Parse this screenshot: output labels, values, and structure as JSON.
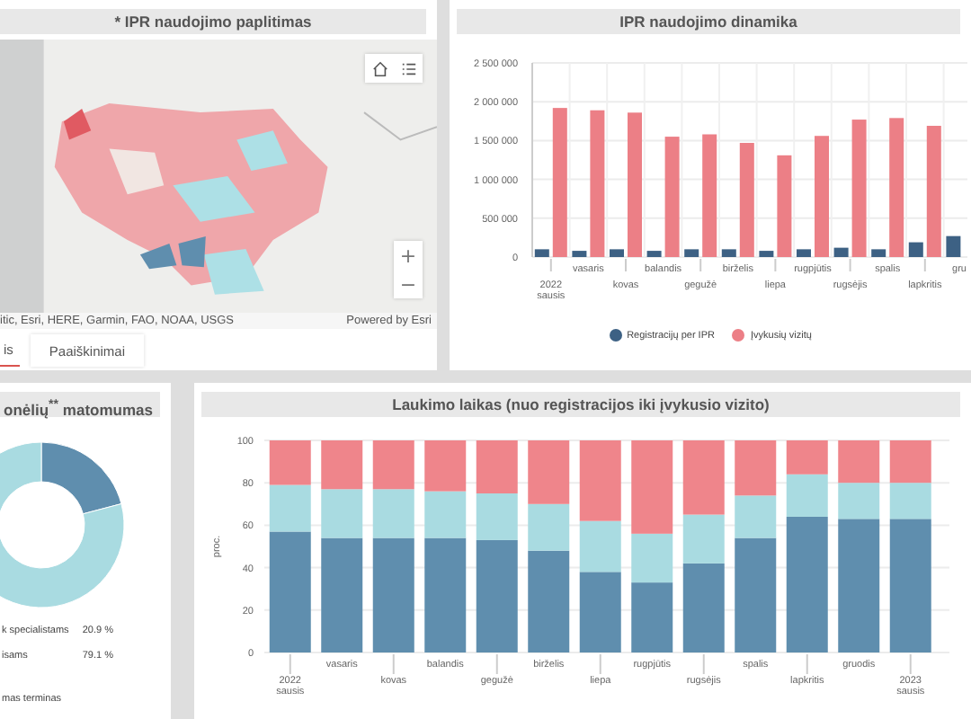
{
  "map_panel": {
    "title": "* IPR naudojimo paplitimas",
    "attribution": "itic, Esri, HERE, Garmin, FAO, NOAA, USGS",
    "powered_by": "Powered by Esri",
    "zoom_in": "+",
    "zoom_out": "−",
    "tabs": [
      {
        "label": "is",
        "selected": true
      },
      {
        "label": "Paaiškinimai",
        "selected": false
      }
    ]
  },
  "dynamics_panel": {
    "title": "IPR naudojimo dinamika",
    "chart_data": {
      "type": "bar",
      "grid": true,
      "categories": [
        "2022\nsausis",
        "vasaris",
        "kovas",
        "balandis",
        "gegužė",
        "birželis",
        "liepa",
        "rugpjūtis",
        "rugsėjis",
        "spalis",
        "lapkritis",
        "gru"
      ],
      "yticks": [
        {
          "value": 0,
          "label": "0"
        },
        {
          "value": 500000,
          "label": "500 000"
        },
        {
          "value": 1000000,
          "label": "1 000 000"
        },
        {
          "value": 1500000,
          "label": "1 500 000"
        },
        {
          "value": 2000000,
          "label": "2 000 000"
        },
        {
          "value": 2500000,
          "label": "2 500 000"
        }
      ],
      "ylim": [
        0,
        2500000
      ],
      "series": [
        {
          "name": "Registracijų per IPR",
          "color": "#3d6184",
          "values": [
            100000,
            80000,
            100000,
            80000,
            100000,
            100000,
            80000,
            100000,
            120000,
            100000,
            190000,
            270000
          ]
        },
        {
          "name": "Įvykusių vizitų",
          "color": "#ec7f86",
          "values": [
            1920000,
            1890000,
            1860000,
            1550000,
            1580000,
            1470000,
            1310000,
            1560000,
            1770000,
            1790000,
            1690000,
            null
          ]
        }
      ]
    }
  },
  "visibility_panel": {
    "title": "onėlių$^{**}$ matomumas",
    "legend": [
      {
        "label": "k specialistams",
        "value": "20.9 %",
        "color": "#5f8eae"
      },
      {
        "label": "isams",
        "value": "79.1 %",
        "color": "#a9dbe1"
      }
    ],
    "note": "mas terminas",
    "chart_data": {
      "type": "donut",
      "values": [
        20.9,
        79.1
      ]
    }
  },
  "waiting_panel": {
    "title": "Laukimo laikas (nuo registracijos iki įvykusio vizito)",
    "chart_data": {
      "type": "bar",
      "stacked": true,
      "grid": true,
      "ylabel": "proc.",
      "ylim": [
        0,
        100
      ],
      "yticks": [
        0,
        20,
        40,
        60,
        80,
        100
      ],
      "categories": [
        "2022\nsausis",
        "vasaris",
        "kovas",
        "balandis",
        "gegužė",
        "birželis",
        "liepa",
        "rugpjūtis",
        "rugsėjis",
        "spalis",
        "lapkritis",
        "gruodis",
        "2023\nsausis"
      ],
      "series": [
        {
          "color": "#5f8eae",
          "values": [
            57,
            54,
            54,
            54,
            53,
            48,
            38,
            33,
            42,
            54,
            64,
            63,
            63
          ]
        },
        {
          "color": "#a9dbe1",
          "values": [
            22,
            23,
            23,
            22,
            22,
            22,
            24,
            23,
            23,
            20,
            20,
            17,
            17
          ]
        },
        {
          "color": "#ef858b",
          "values": [
            21,
            23,
            23,
            24,
            25,
            30,
            38,
            44,
            35,
            26,
            16,
            20,
            20
          ]
        }
      ]
    }
  }
}
